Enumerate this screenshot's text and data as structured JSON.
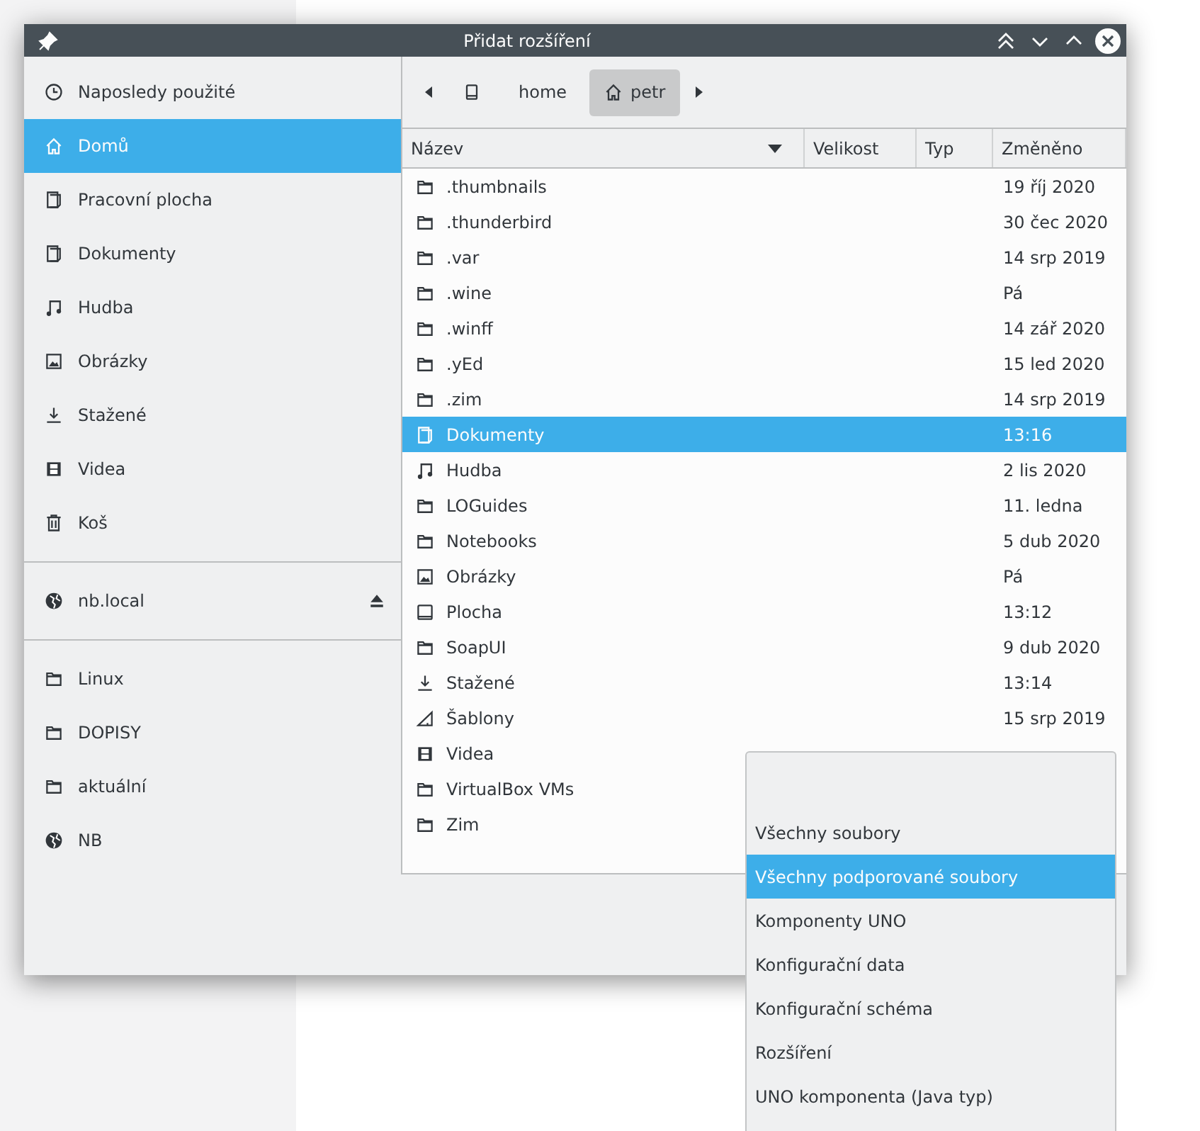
{
  "window": {
    "title": "Přidat rozšíření"
  },
  "sidebar": {
    "groups": [
      [
        {
          "label": "Naposledy použité",
          "kind": "recent",
          "selected": false
        },
        {
          "label": "Domů",
          "kind": "home",
          "selected": true
        },
        {
          "label": "Pracovní plocha",
          "kind": "document",
          "selected": false
        },
        {
          "label": "Dokumenty",
          "kind": "document",
          "selected": false
        },
        {
          "label": "Hudba",
          "kind": "music",
          "selected": false
        },
        {
          "label": "Obrázky",
          "kind": "image",
          "selected": false
        },
        {
          "label": "Stažené",
          "kind": "download",
          "selected": false
        },
        {
          "label": "Videa",
          "kind": "film",
          "selected": false
        },
        {
          "label": "Koš",
          "kind": "trash",
          "selected": false
        }
      ],
      [
        {
          "label": "nb.local",
          "kind": "mount",
          "selected": false
        }
      ],
      [
        {
          "label": "Linux",
          "kind": "folder",
          "selected": false
        },
        {
          "label": "DOPISY",
          "kind": "folder",
          "selected": false
        },
        {
          "label": "aktuální",
          "kind": "folder",
          "selected": false
        },
        {
          "label": "NB",
          "kind": "network",
          "selected": false
        }
      ]
    ]
  },
  "breadcrumb": [
    {
      "kind": "drive",
      "selected": false
    },
    {
      "label": "home",
      "kind": "text",
      "selected": false
    },
    {
      "label": "petr",
      "kind": "home",
      "selected": true
    }
  ],
  "table": {
    "columns": [
      "Název",
      "Velikost",
      "Typ",
      "Změněno"
    ],
    "rows": [
      {
        "name": ".thumbnails",
        "kind": "folder",
        "modified": "19 říj 2020",
        "selected": false
      },
      {
        "name": ".thunderbird",
        "kind": "folder",
        "modified": "30 čec 2020",
        "selected": false
      },
      {
        "name": ".var",
        "kind": "folder",
        "modified": "14 srp 2019",
        "selected": false
      },
      {
        "name": ".wine",
        "kind": "folder",
        "modified": "Pá",
        "selected": false
      },
      {
        "name": ".winff",
        "kind": "folder",
        "modified": "14 zář 2020",
        "selected": false
      },
      {
        "name": ".yEd",
        "kind": "folder",
        "modified": "15 led 2020",
        "selected": false
      },
      {
        "name": ".zim",
        "kind": "folder",
        "modified": "14 srp 2019",
        "selected": false
      },
      {
        "name": "Dokumenty",
        "kind": "document",
        "modified": "13:16",
        "selected": true
      },
      {
        "name": "Hudba",
        "kind": "music",
        "modified": "2 lis 2020",
        "selected": false
      },
      {
        "name": "LOGuides",
        "kind": "folder",
        "modified": "11. ledna",
        "selected": false
      },
      {
        "name": "Notebooks",
        "kind": "folder",
        "modified": "5 dub 2020",
        "selected": false
      },
      {
        "name": "Obrázky",
        "kind": "image",
        "modified": "Pá",
        "selected": false
      },
      {
        "name": "Plocha",
        "kind": "desktop",
        "modified": "13:12",
        "selected": false
      },
      {
        "name": "SoapUI",
        "kind": "folder",
        "modified": "9 dub 2020",
        "selected": false
      },
      {
        "name": "Stažené",
        "kind": "download",
        "modified": "13:14",
        "selected": false
      },
      {
        "name": "Šablony",
        "kind": "template",
        "modified": "15 srp 2019",
        "selected": false
      },
      {
        "name": "Videa",
        "kind": "film",
        "selected": false
      },
      {
        "name": "VirtualBox VMs",
        "kind": "folder",
        "selected": false
      },
      {
        "name": "Zim",
        "kind": "folder",
        "selected": false
      }
    ]
  },
  "filter_menu": [
    {
      "label": "Všechny soubory",
      "selected": false
    },
    {
      "label": "Všechny podporované soubory",
      "selected": true
    },
    {
      "label": "Komponenty UNO",
      "selected": false
    },
    {
      "label": "Konfigurační data",
      "selected": false
    },
    {
      "label": "Konfigurační schéma",
      "selected": false
    },
    {
      "label": "Rozšíření",
      "selected": false
    },
    {
      "label": "UNO komponenta (Java typ)",
      "selected": false
    }
  ]
}
